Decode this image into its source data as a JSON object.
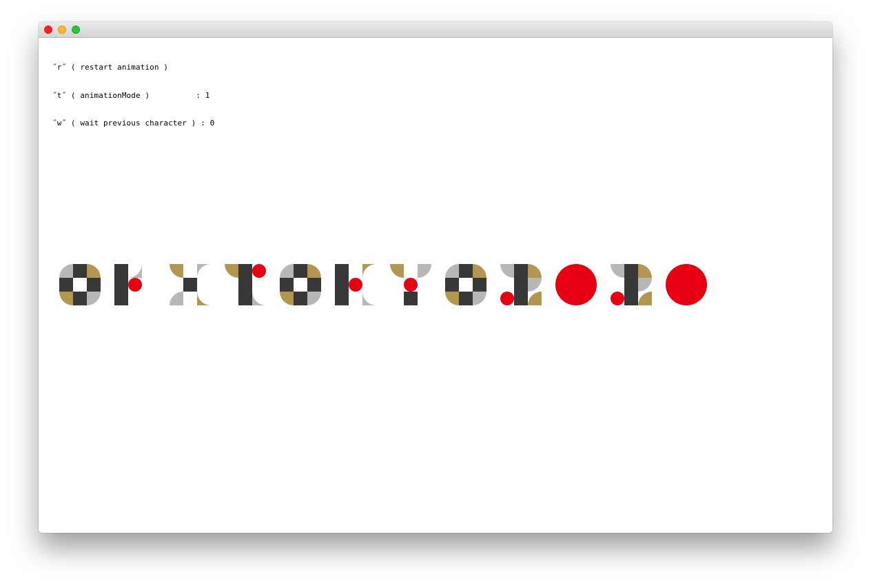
{
  "window": {
    "controls": [
      "close",
      "minimize",
      "zoom"
    ]
  },
  "help": {
    "lines": [
      "˝r˝ ( restart animation )",
      "˝t˝ ( animationMode )          : 1",
      "˝w˝ ( wait previous character ) : 0"
    ]
  },
  "palette": {
    "dark": "#383838",
    "gray": "#b7b7b7",
    "gold": "#b39650",
    "red": "#e60012",
    "background": "#ffffff"
  }
}
